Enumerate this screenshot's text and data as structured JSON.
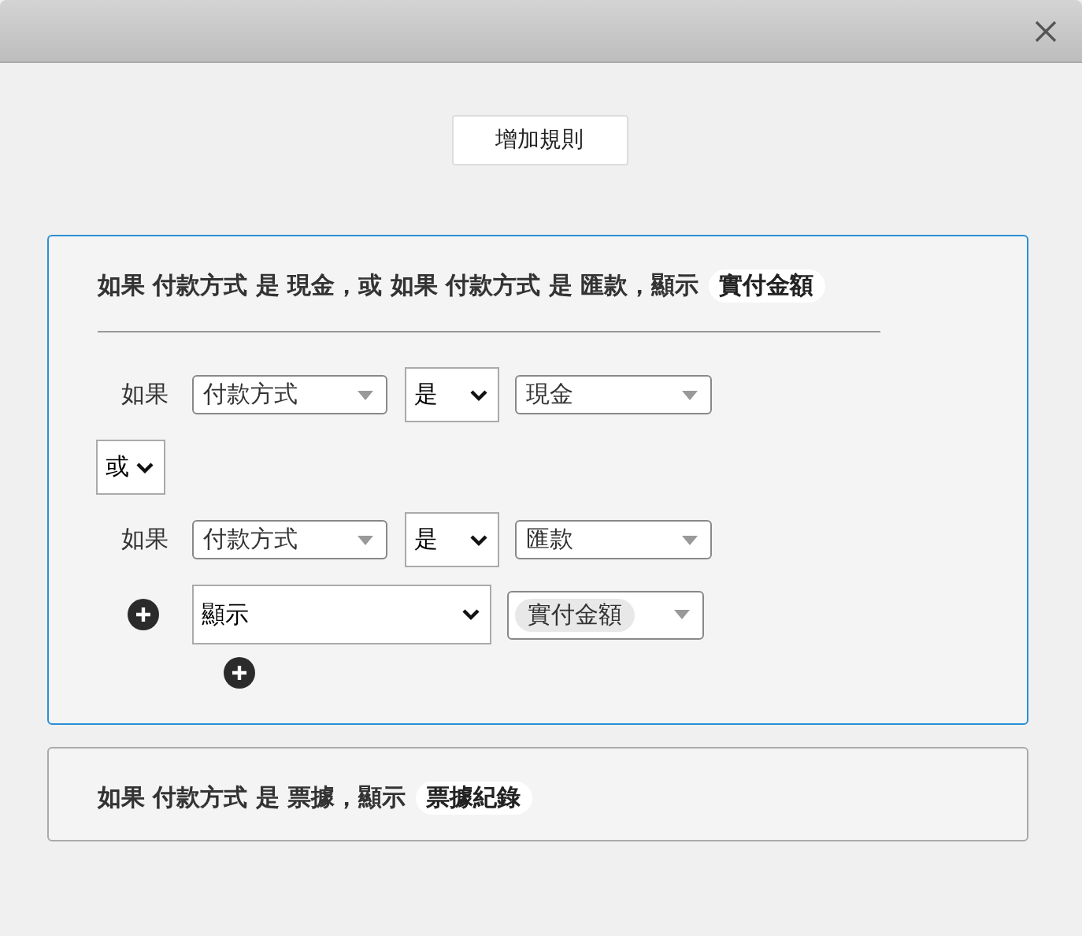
{
  "add_rule_button": "增加規則",
  "rules": [
    {
      "selected": true,
      "summary": [
        {
          "kind": "text",
          "text": "如果 付款方式 是 現金，或 如果 付款方式 是 匯款，顯示"
        },
        {
          "kind": "chip",
          "text": "實付金額"
        }
      ],
      "editor": [
        {
          "kind": "condition",
          "label": "如果",
          "field": "付款方式",
          "operator": "是",
          "value": "現金"
        },
        {
          "kind": "connector",
          "value": "或"
        },
        {
          "kind": "condition",
          "label": "如果",
          "field": "付款方式",
          "operator": "是",
          "value": "匯款"
        },
        {
          "kind": "action",
          "action": "顯示",
          "value": "實付金額"
        }
      ]
    },
    {
      "selected": false,
      "summary": [
        {
          "kind": "text",
          "text": "如果 付款方式 是 票據，顯示"
        },
        {
          "kind": "chip",
          "text": "票據紀錄"
        }
      ]
    }
  ]
}
